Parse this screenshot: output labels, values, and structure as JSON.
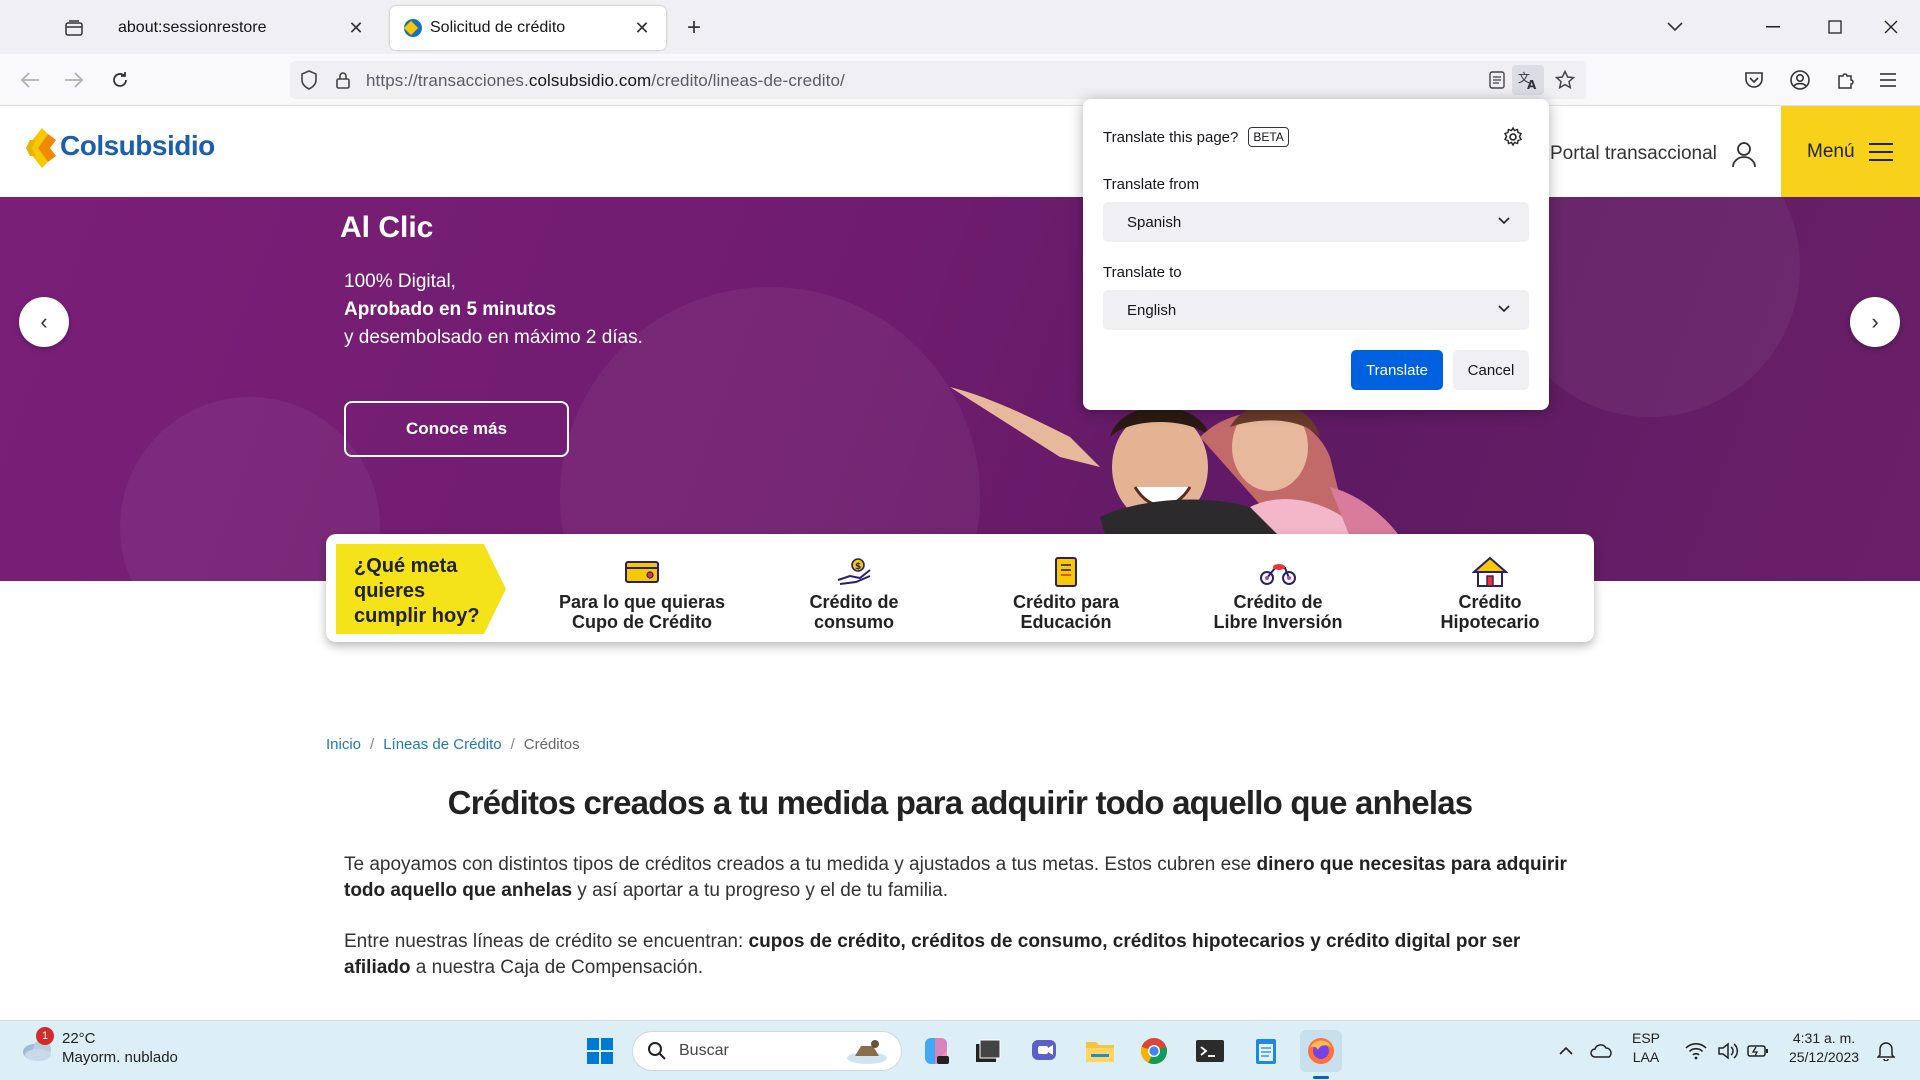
{
  "browser": {
    "tabs": [
      {
        "title": "about:sessionrestore",
        "active": false
      },
      {
        "title": "Solicitud de crédito",
        "active": true
      }
    ],
    "url": {
      "prefix": "https://transacciones.",
      "domain": "colsubsidio.com",
      "path": "/credito/lineas-de-credito/"
    }
  },
  "site": {
    "logo_text": "Colsubsidio",
    "portal_label": "Portal transaccional",
    "menu_label": "Menú"
  },
  "hero": {
    "title": "Al Clic",
    "line1": "100% Digital,",
    "line2": "Aprobado en 5 minutos",
    "line3": "y desembolsado en máximo 2 días.",
    "button": "Conoce más",
    "prev": "‹",
    "next": "›"
  },
  "goals": {
    "badge": [
      "¿Qué meta",
      "quieres",
      "cumplir hoy?"
    ],
    "items": [
      {
        "icon": "credit-card-icon",
        "line1": "Para lo que quieras",
        "line2": "Cupo de Crédito"
      },
      {
        "icon": "hand-money-icon",
        "line1": "Crédito de",
        "line2": "consumo"
      },
      {
        "icon": "notebook-icon",
        "line1": "Crédito para",
        "line2": "Educación"
      },
      {
        "icon": "motorcycle-icon",
        "line1": "Crédito de",
        "line2": "Libre Inversión"
      },
      {
        "icon": "house-icon",
        "line1": "Crédito",
        "line2": "Hipotecario"
      }
    ]
  },
  "breadcrumb": {
    "home": "Inicio",
    "section": "Líneas de Crédito",
    "current": "Créditos",
    "separator": "/"
  },
  "content": {
    "heading": "Créditos creados a tu medida para adquirir todo aquello que anhelas",
    "p1_a": "Te apoyamos con distintos tipos de créditos creados a tu medida y ajustados a tus metas. Estos cubren ese ",
    "p1_b": "dinero que necesitas para adquirir todo aquello que anhelas",
    "p1_c": " y así aportar a tu progreso y el de tu familia.",
    "p2_a": "Entre nuestras líneas de crédito se encuentran: ",
    "p2_b": "cupos de crédito, créditos de consumo, créditos hipotecarios y crédito digital por ser afiliado",
    "p2_c": " a nuestra Caja de Compensación."
  },
  "translate_popup": {
    "title": "Translate this page?",
    "badge": "BETA",
    "from_label": "Translate from",
    "from_value": "Spanish",
    "to_label": "Translate to",
    "to_value": "English",
    "translate_btn": "Translate",
    "cancel_btn": "Cancel"
  },
  "taskbar": {
    "weather_temp": "22°C",
    "weather_desc": "Mayorm. nublado",
    "weather_badge": "1",
    "search_placeholder": "Buscar",
    "lang_top": "ESP",
    "lang_bottom": "LAA",
    "time": "4:31 a. m.",
    "date": "25/12/2023"
  },
  "colors": {
    "brand_blue": "#1b5fad",
    "brand_yellow": "#f8d21a",
    "hero_purple": "#6f1c6e",
    "translate_blue": "#0061e0"
  }
}
